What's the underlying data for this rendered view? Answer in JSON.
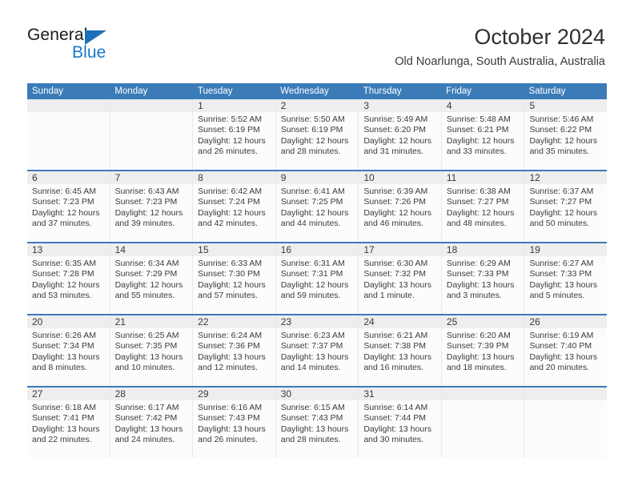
{
  "brand": {
    "name_top": "General",
    "name_bottom": "Blue",
    "triangle_color": "#1d6fb8",
    "blue_text_color": "#1877c9"
  },
  "header": {
    "month_title": "October 2024",
    "location": "Old Noarlunga, South Australia, Australia"
  },
  "theme": {
    "header_blue": "#3b7cb8",
    "daynum_band": "#eeeeee",
    "cell_bg": "#fcfcfd",
    "text": "#3b3b3b"
  },
  "calendar": {
    "weekday_headers": [
      "Sunday",
      "Monday",
      "Tuesday",
      "Wednesday",
      "Thursday",
      "Friday",
      "Saturday"
    ],
    "labels": {
      "sunrise": "Sunrise:",
      "sunset": "Sunset:",
      "daylight": "Daylight:"
    },
    "weeks": [
      [
        {
          "day": "",
          "sunrise": "",
          "sunset": "",
          "daylight_line1": "",
          "daylight_line2": ""
        },
        {
          "day": "",
          "sunrise": "",
          "sunset": "",
          "daylight_line1": "",
          "daylight_line2": ""
        },
        {
          "day": "1",
          "sunrise": "Sunrise: 5:52 AM",
          "sunset": "Sunset: 6:19 PM",
          "daylight_line1": "Daylight: 12 hours",
          "daylight_line2": "and 26 minutes."
        },
        {
          "day": "2",
          "sunrise": "Sunrise: 5:50 AM",
          "sunset": "Sunset: 6:19 PM",
          "daylight_line1": "Daylight: 12 hours",
          "daylight_line2": "and 28 minutes."
        },
        {
          "day": "3",
          "sunrise": "Sunrise: 5:49 AM",
          "sunset": "Sunset: 6:20 PM",
          "daylight_line1": "Daylight: 12 hours",
          "daylight_line2": "and 31 minutes."
        },
        {
          "day": "4",
          "sunrise": "Sunrise: 5:48 AM",
          "sunset": "Sunset: 6:21 PM",
          "daylight_line1": "Daylight: 12 hours",
          "daylight_line2": "and 33 minutes."
        },
        {
          "day": "5",
          "sunrise": "Sunrise: 5:46 AM",
          "sunset": "Sunset: 6:22 PM",
          "daylight_line1": "Daylight: 12 hours",
          "daylight_line2": "and 35 minutes."
        }
      ],
      [
        {
          "day": "6",
          "sunrise": "Sunrise: 6:45 AM",
          "sunset": "Sunset: 7:23 PM",
          "daylight_line1": "Daylight: 12 hours",
          "daylight_line2": "and 37 minutes."
        },
        {
          "day": "7",
          "sunrise": "Sunrise: 6:43 AM",
          "sunset": "Sunset: 7:23 PM",
          "daylight_line1": "Daylight: 12 hours",
          "daylight_line2": "and 39 minutes."
        },
        {
          "day": "8",
          "sunrise": "Sunrise: 6:42 AM",
          "sunset": "Sunset: 7:24 PM",
          "daylight_line1": "Daylight: 12 hours",
          "daylight_line2": "and 42 minutes."
        },
        {
          "day": "9",
          "sunrise": "Sunrise: 6:41 AM",
          "sunset": "Sunset: 7:25 PM",
          "daylight_line1": "Daylight: 12 hours",
          "daylight_line2": "and 44 minutes."
        },
        {
          "day": "10",
          "sunrise": "Sunrise: 6:39 AM",
          "sunset": "Sunset: 7:26 PM",
          "daylight_line1": "Daylight: 12 hours",
          "daylight_line2": "and 46 minutes."
        },
        {
          "day": "11",
          "sunrise": "Sunrise: 6:38 AM",
          "sunset": "Sunset: 7:27 PM",
          "daylight_line1": "Daylight: 12 hours",
          "daylight_line2": "and 48 minutes."
        },
        {
          "day": "12",
          "sunrise": "Sunrise: 6:37 AM",
          "sunset": "Sunset: 7:27 PM",
          "daylight_line1": "Daylight: 12 hours",
          "daylight_line2": "and 50 minutes."
        }
      ],
      [
        {
          "day": "13",
          "sunrise": "Sunrise: 6:35 AM",
          "sunset": "Sunset: 7:28 PM",
          "daylight_line1": "Daylight: 12 hours",
          "daylight_line2": "and 53 minutes."
        },
        {
          "day": "14",
          "sunrise": "Sunrise: 6:34 AM",
          "sunset": "Sunset: 7:29 PM",
          "daylight_line1": "Daylight: 12 hours",
          "daylight_line2": "and 55 minutes."
        },
        {
          "day": "15",
          "sunrise": "Sunrise: 6:33 AM",
          "sunset": "Sunset: 7:30 PM",
          "daylight_line1": "Daylight: 12 hours",
          "daylight_line2": "and 57 minutes."
        },
        {
          "day": "16",
          "sunrise": "Sunrise: 6:31 AM",
          "sunset": "Sunset: 7:31 PM",
          "daylight_line1": "Daylight: 12 hours",
          "daylight_line2": "and 59 minutes."
        },
        {
          "day": "17",
          "sunrise": "Sunrise: 6:30 AM",
          "sunset": "Sunset: 7:32 PM",
          "daylight_line1": "Daylight: 13 hours",
          "daylight_line2": "and 1 minute."
        },
        {
          "day": "18",
          "sunrise": "Sunrise: 6:29 AM",
          "sunset": "Sunset: 7:33 PM",
          "daylight_line1": "Daylight: 13 hours",
          "daylight_line2": "and 3 minutes."
        },
        {
          "day": "19",
          "sunrise": "Sunrise: 6:27 AM",
          "sunset": "Sunset: 7:33 PM",
          "daylight_line1": "Daylight: 13 hours",
          "daylight_line2": "and 5 minutes."
        }
      ],
      [
        {
          "day": "20",
          "sunrise": "Sunrise: 6:26 AM",
          "sunset": "Sunset: 7:34 PM",
          "daylight_line1": "Daylight: 13 hours",
          "daylight_line2": "and 8 minutes."
        },
        {
          "day": "21",
          "sunrise": "Sunrise: 6:25 AM",
          "sunset": "Sunset: 7:35 PM",
          "daylight_line1": "Daylight: 13 hours",
          "daylight_line2": "and 10 minutes."
        },
        {
          "day": "22",
          "sunrise": "Sunrise: 6:24 AM",
          "sunset": "Sunset: 7:36 PM",
          "daylight_line1": "Daylight: 13 hours",
          "daylight_line2": "and 12 minutes."
        },
        {
          "day": "23",
          "sunrise": "Sunrise: 6:23 AM",
          "sunset": "Sunset: 7:37 PM",
          "daylight_line1": "Daylight: 13 hours",
          "daylight_line2": "and 14 minutes."
        },
        {
          "day": "24",
          "sunrise": "Sunrise: 6:21 AM",
          "sunset": "Sunset: 7:38 PM",
          "daylight_line1": "Daylight: 13 hours",
          "daylight_line2": "and 16 minutes."
        },
        {
          "day": "25",
          "sunrise": "Sunrise: 6:20 AM",
          "sunset": "Sunset: 7:39 PM",
          "daylight_line1": "Daylight: 13 hours",
          "daylight_line2": "and 18 minutes."
        },
        {
          "day": "26",
          "sunrise": "Sunrise: 6:19 AM",
          "sunset": "Sunset: 7:40 PM",
          "daylight_line1": "Daylight: 13 hours",
          "daylight_line2": "and 20 minutes."
        }
      ],
      [
        {
          "day": "27",
          "sunrise": "Sunrise: 6:18 AM",
          "sunset": "Sunset: 7:41 PM",
          "daylight_line1": "Daylight: 13 hours",
          "daylight_line2": "and 22 minutes."
        },
        {
          "day": "28",
          "sunrise": "Sunrise: 6:17 AM",
          "sunset": "Sunset: 7:42 PM",
          "daylight_line1": "Daylight: 13 hours",
          "daylight_line2": "and 24 minutes."
        },
        {
          "day": "29",
          "sunrise": "Sunrise: 6:16 AM",
          "sunset": "Sunset: 7:43 PM",
          "daylight_line1": "Daylight: 13 hours",
          "daylight_line2": "and 26 minutes."
        },
        {
          "day": "30",
          "sunrise": "Sunrise: 6:15 AM",
          "sunset": "Sunset: 7:43 PM",
          "daylight_line1": "Daylight: 13 hours",
          "daylight_line2": "and 28 minutes."
        },
        {
          "day": "31",
          "sunrise": "Sunrise: 6:14 AM",
          "sunset": "Sunset: 7:44 PM",
          "daylight_line1": "Daylight: 13 hours",
          "daylight_line2": "and 30 minutes."
        },
        {
          "day": "",
          "sunrise": "",
          "sunset": "",
          "daylight_line1": "",
          "daylight_line2": ""
        },
        {
          "day": "",
          "sunrise": "",
          "sunset": "",
          "daylight_line1": "",
          "daylight_line2": ""
        }
      ]
    ]
  }
}
